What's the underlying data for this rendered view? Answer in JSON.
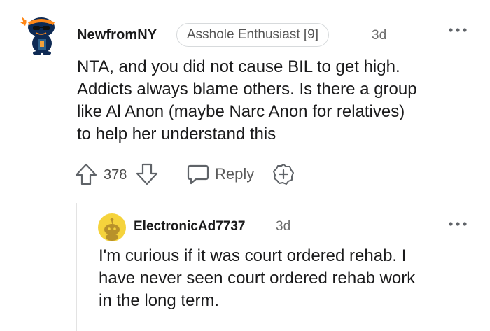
{
  "comment": {
    "username": "NewfromNY",
    "flair": "Asshole Enthusiast [9]",
    "time": "3d",
    "body_lines": [
      "NTA, and you did not cause BIL to get high.",
      "Addicts always blame others. Is there a group",
      "like Al Anon (maybe Narc Anon for relatives)",
      "to help her understand this"
    ],
    "score": "378",
    "reply_label": "Reply"
  },
  "reply": {
    "username": "ElectronicAd7737",
    "time": "3d",
    "body_lines": [
      "I'm curious if it was court ordered rehab. I",
      "have never seen court ordered rehab work",
      "in the long term."
    ]
  },
  "colors": {
    "text": "#1a1a1b",
    "muted": "#6b6b6b",
    "border": "#d7dadc",
    "avatar_bg": "#0e2a54",
    "avatar_accent": "#ff8717",
    "reply_avatar_bg": "#f5d33c"
  },
  "icons": [
    "avatar-snoo",
    "more-options-icon",
    "upvote-icon",
    "downvote-icon",
    "reply-icon",
    "award-icon"
  ]
}
